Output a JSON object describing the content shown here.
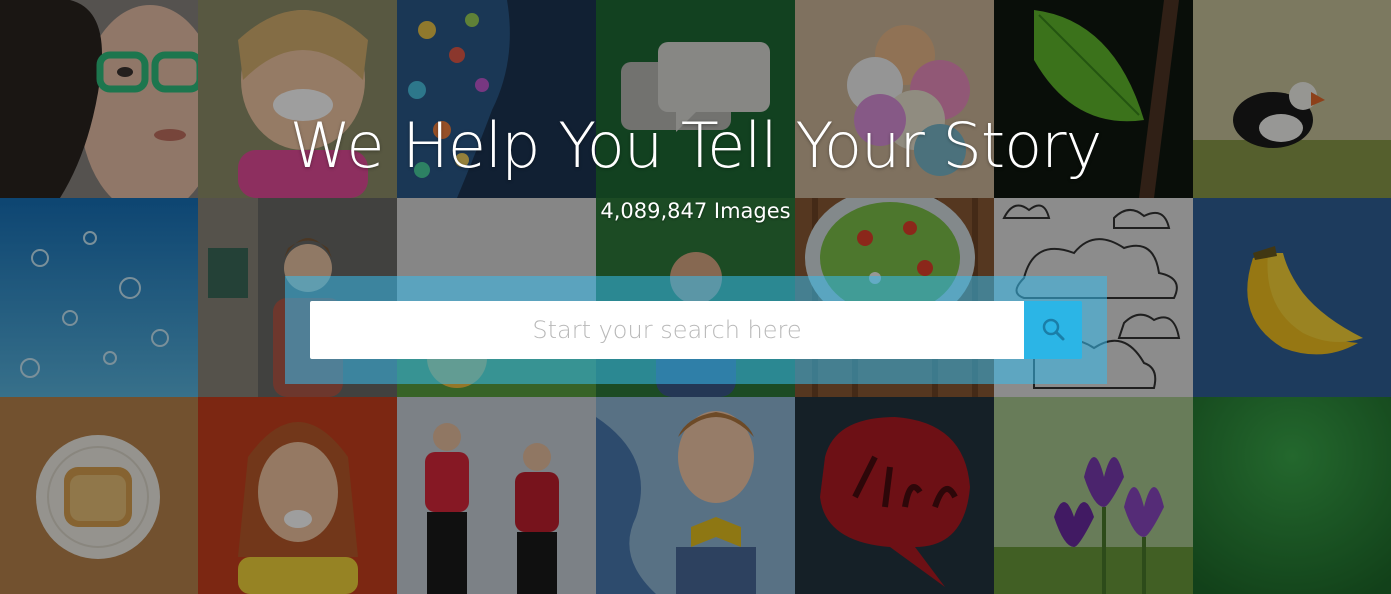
{
  "hero": {
    "title": "We Help You Tell Your Story",
    "image_count": "4,089,847 Images"
  },
  "search": {
    "placeholder": "Start your search here",
    "value": "",
    "button_icon": "search-icon"
  },
  "colors": {
    "accent": "#2bb5e6",
    "panel": "#38bcec"
  }
}
